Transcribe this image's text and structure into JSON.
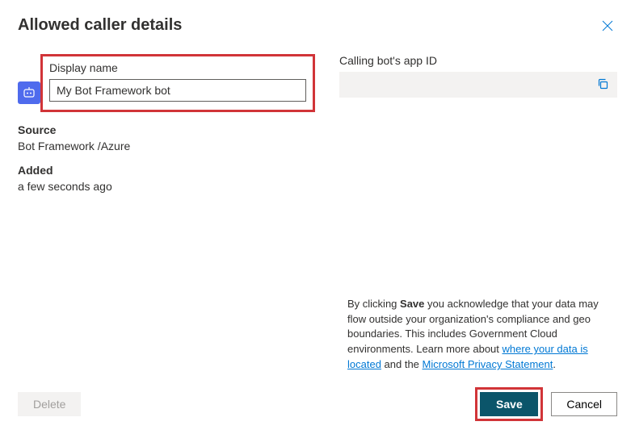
{
  "header": {
    "title": "Allowed caller details"
  },
  "left": {
    "displayName": {
      "label": "Display name",
      "value": "My Bot Framework bot"
    },
    "source": {
      "label": "Source",
      "value": "Bot Framework /Azure"
    },
    "added": {
      "label": "Added",
      "value": "a few seconds ago"
    }
  },
  "right": {
    "appId": {
      "label": "Calling bot's app ID",
      "value": ""
    }
  },
  "disclaimer": {
    "pre": "By clicking ",
    "bold": "Save",
    "mid": " you acknowledge that your data may flow outside your organization's compliance and geo boundaries. This includes Government Cloud environments. Learn more about ",
    "link1": "where your data is located",
    "and": " and the ",
    "link2": "Microsoft Privacy Statement",
    "end": "."
  },
  "footer": {
    "delete": "Delete",
    "save": "Save",
    "cancel": "Cancel"
  }
}
